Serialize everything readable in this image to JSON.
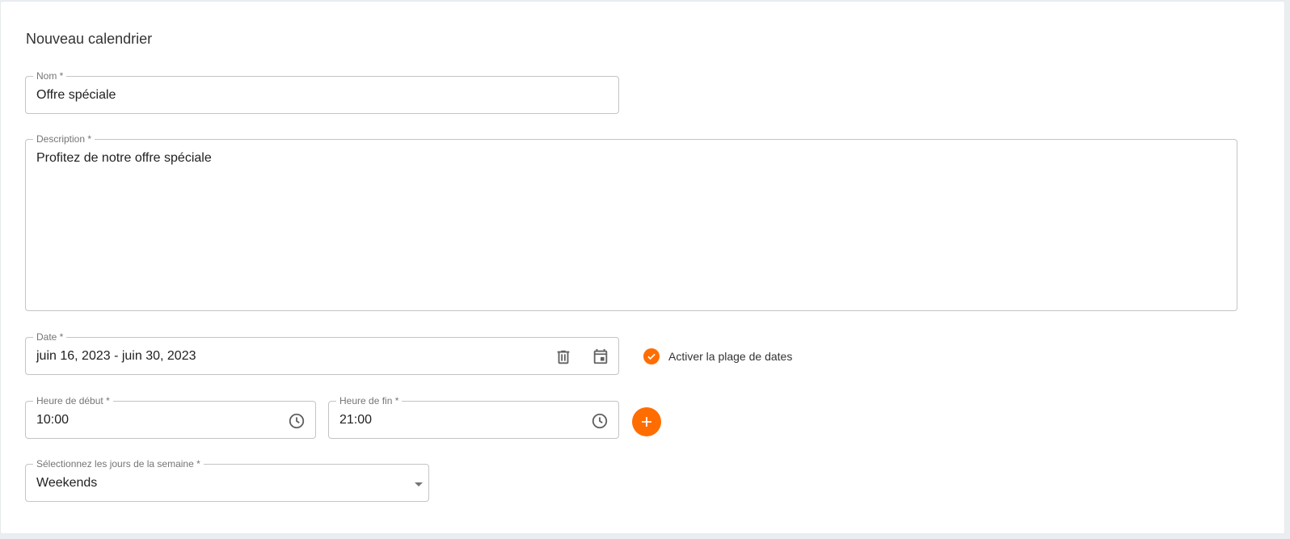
{
  "form": {
    "title": "Nouveau calendrier",
    "name": {
      "label": "Nom *",
      "value": "Offre spéciale"
    },
    "description": {
      "label": "Description *",
      "value": "Profitez de notre offre spéciale"
    },
    "date": {
      "label": "Date *",
      "value": "juin 16, 2023 - juin 30, 2023"
    },
    "date_range_toggle": {
      "label": "Activer la plage de dates",
      "checked": true
    },
    "start_time": {
      "label": "Heure de début *",
      "value": "10:00"
    },
    "end_time": {
      "label": "Heure de fin *",
      "value": "21:00"
    },
    "weekdays": {
      "label": "Sélectionnez les jours de la semaine *",
      "value": "Weekends"
    }
  },
  "icons": {
    "clear_date": "trash-icon",
    "open_calendar": "calendar-icon",
    "start_clock": "clock-icon",
    "end_clock": "clock-icon",
    "add": "plus-icon",
    "check": "check-icon",
    "dropdown": "chevron-down-icon"
  },
  "colors": {
    "accent": "#ff6d00",
    "border": "#c4c4c4",
    "label": "#757575",
    "text": "#212121",
    "page_bg": "#ebeef1"
  }
}
